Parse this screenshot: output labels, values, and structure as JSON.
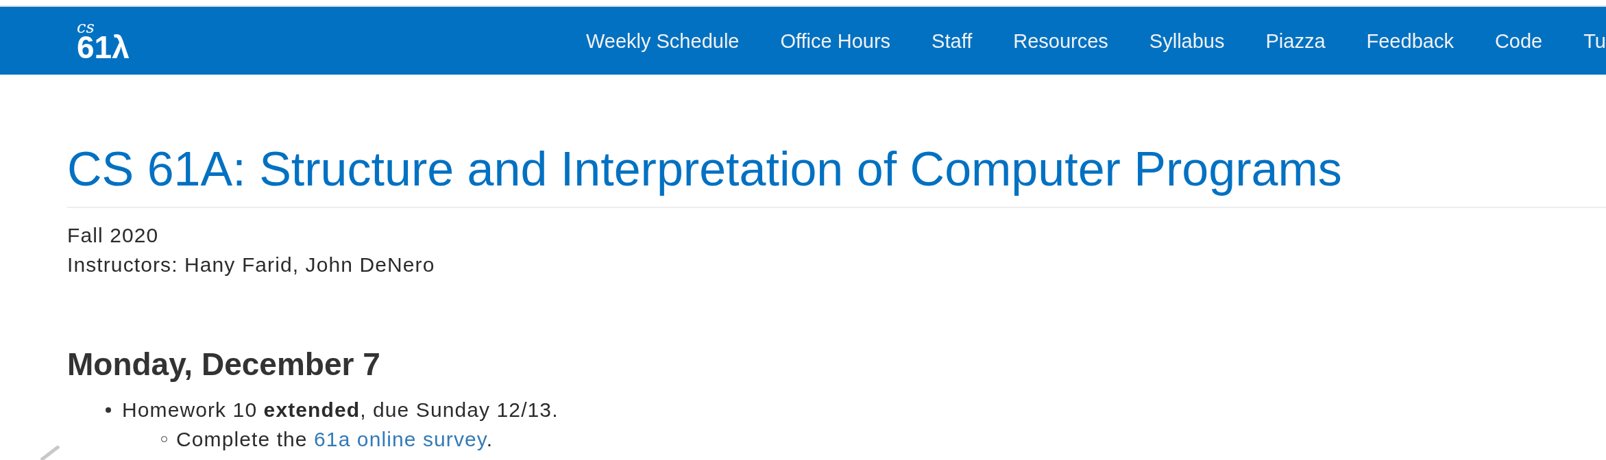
{
  "nav": {
    "logo": {
      "script": "cs",
      "mark": "61λ"
    },
    "items": [
      {
        "label": "Weekly Schedule"
      },
      {
        "label": "Office Hours"
      },
      {
        "label": "Staff"
      },
      {
        "label": "Resources"
      },
      {
        "label": "Syllabus"
      },
      {
        "label": "Piazza"
      },
      {
        "label": "Feedback"
      },
      {
        "label": "Code"
      },
      {
        "label": "Tu"
      }
    ]
  },
  "header": {
    "title": "CS 61A: Structure and Interpretation of Computer Programs",
    "term": "Fall 2020",
    "instructors": "Instructors: Hany Farid, John DeNero"
  },
  "announcements": [
    {
      "date": "Monday, December 7",
      "items": [
        {
          "text": "Homework 10 **extended**, due Sunday 12/13.",
          "children": [
            {
              "text_before": "Complete the ",
              "link": "61a online survey",
              "text_after": "."
            }
          ]
        }
      ]
    }
  ]
}
